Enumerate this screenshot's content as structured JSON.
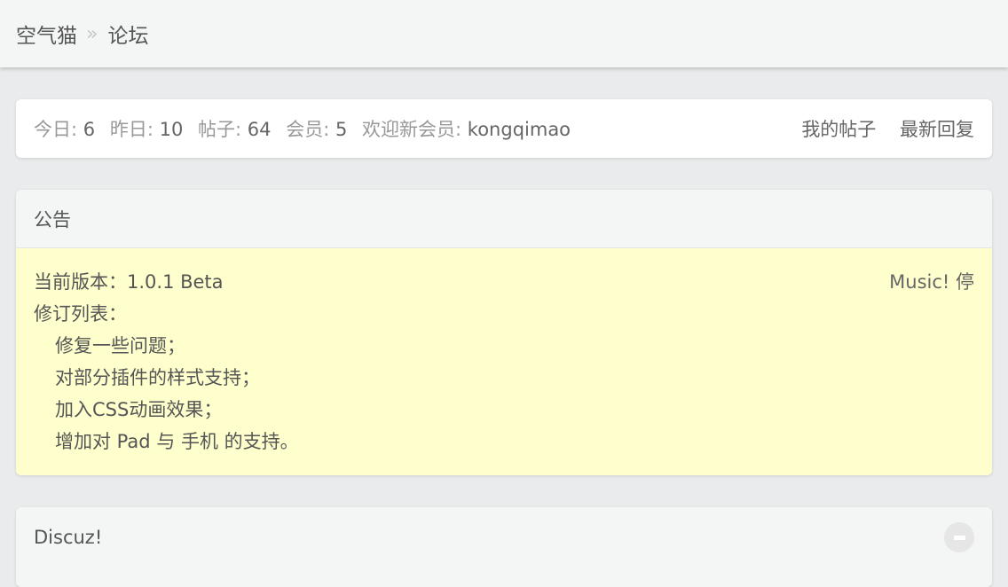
{
  "breadcrumb": {
    "site": "空气猫",
    "separator": "»",
    "current": "论坛"
  },
  "stats": {
    "today_label": "今日:",
    "today_value": "6",
    "yesterday_label": "昨日:",
    "yesterday_value": "10",
    "posts_label": "帖子:",
    "posts_value": "64",
    "members_label": "会员:",
    "members_value": "5",
    "newest_label": "欢迎新会员:",
    "newest_value": "kongqimao",
    "my_posts_link": "我的帖子",
    "latest_replies_link": "最新回复"
  },
  "notice": {
    "title": "公告",
    "music_label": "Music! 停",
    "version_label": "当前版本：",
    "version_value": "1.0.1 Beta",
    "revisions_label": "修订列表：",
    "revisions": [
      "修复一些问题；",
      "对部分插件的样式支持；",
      "加入CSS动画效果；",
      "增加对 Pad 与 手机 的支持。"
    ]
  },
  "forum": {
    "title": "Discuz!"
  },
  "colors": {
    "background": "#e9ebec",
    "notice_background": "#ffffcd",
    "header_background": "#f4f5f5"
  }
}
